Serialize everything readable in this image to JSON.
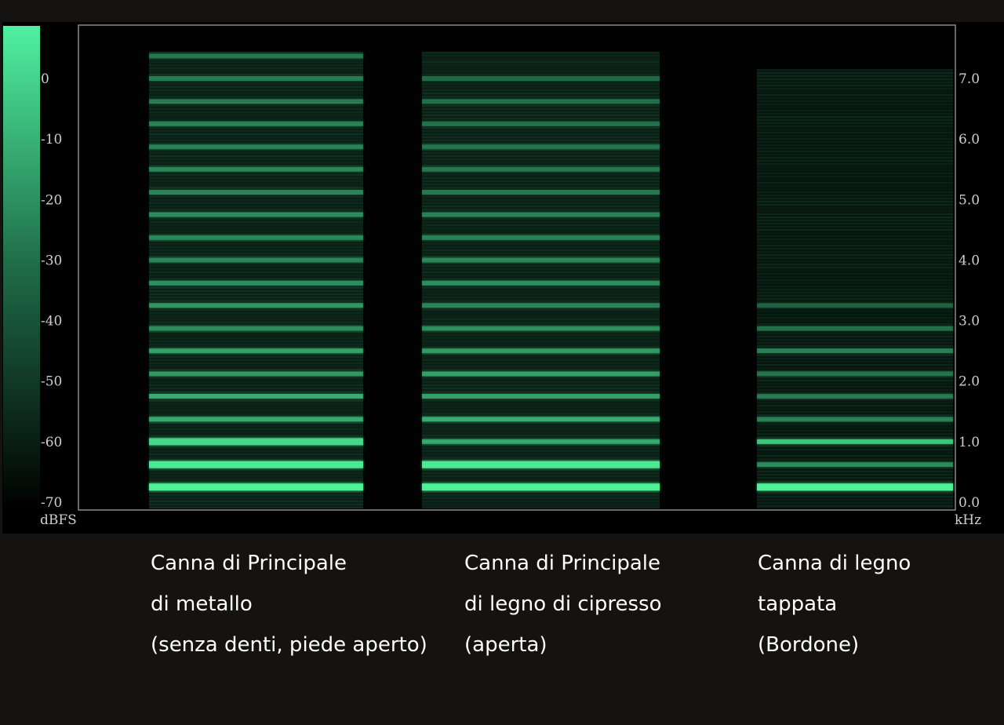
{
  "chart_data": {
    "type": "heatmap",
    "title": "",
    "color_scale": {
      "label": "dBFS",
      "ticks": [
        "0",
        "-10",
        "-20",
        "-30",
        "-40",
        "-50",
        "-60",
        "-70"
      ],
      "range": [
        -70,
        0
      ],
      "colors": [
        "#000000",
        "#4ff0a0"
      ]
    },
    "frequency_axis": {
      "label": "kHz",
      "ticks": [
        "0.0",
        "1.0",
        "2.0",
        "3.0",
        "4.0",
        "5.0",
        "6.0",
        "7.0"
      ],
      "range": [
        0.0,
        7.7
      ]
    },
    "segments": [
      {
        "name": "Canna di Principale di metallo (senza denti, piede aperto)",
        "harmonics_khz": [
          0.25,
          0.62,
          1.0,
          1.37,
          1.75,
          2.12,
          2.5,
          2.87,
          3.25,
          3.62,
          4.0,
          4.37,
          4.75,
          5.12,
          5.5,
          5.87,
          6.25,
          6.62,
          7.0,
          7.37
        ],
        "harmonics_level": [
          1.0,
          0.95,
          0.85,
          0.6,
          0.62,
          0.5,
          0.55,
          0.45,
          0.5,
          0.45,
          0.4,
          0.42,
          0.45,
          0.4,
          0.42,
          0.38,
          0.38,
          0.35,
          0.35,
          0.32
        ]
      },
      {
        "name": "Canna di Principale di legno di cipresso (aperta)",
        "harmonics_khz": [
          0.25,
          0.62,
          1.0,
          1.37,
          1.75,
          2.12,
          2.5,
          2.87,
          3.25,
          3.62,
          4.0,
          4.37,
          4.75,
          5.12,
          5.5,
          5.87,
          6.25,
          6.62,
          7.0
        ],
        "harmonics_level": [
          1.0,
          0.95,
          0.6,
          0.62,
          0.55,
          0.55,
          0.5,
          0.45,
          0.4,
          0.45,
          0.42,
          0.38,
          0.38,
          0.32,
          0.32,
          0.3,
          0.28,
          0.28,
          0.25
        ]
      },
      {
        "name": "Canna di legno tappata (Bordone)",
        "harmonics_khz": [
          0.25,
          0.62,
          1.0,
          1.37,
          1.75,
          2.12,
          2.5,
          2.87,
          3.25
        ],
        "harmonics_level": [
          1.0,
          0.45,
          0.75,
          0.4,
          0.35,
          0.32,
          0.38,
          0.3,
          0.22
        ]
      }
    ]
  },
  "captions": [
    {
      "line1": "Canna di Principale",
      "line2": "di metallo",
      "line3": "(senza denti, piede aperto)"
    },
    {
      "line1": "Canna di Principale",
      "line2": "di legno di cipresso",
      "line3": "(aperta)"
    },
    {
      "line1": "Canna di legno",
      "line2": "tappata",
      "line3": "(Bordone)"
    }
  ]
}
